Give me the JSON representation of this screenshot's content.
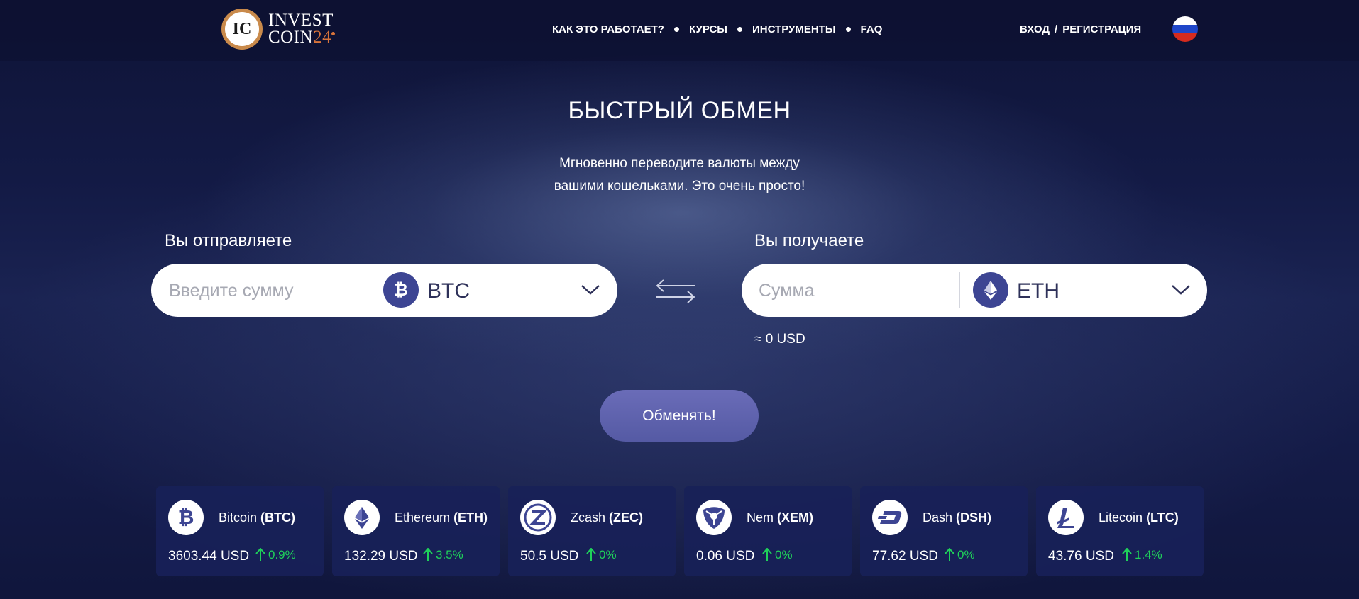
{
  "header": {
    "logo": {
      "line1": "INVEST",
      "line2": "COIN",
      "line2_num": "24",
      "mark": "IC"
    },
    "nav": [
      "КАК ЭТО РАБОТАЕТ?",
      "КУРСЫ",
      "ИНСТРУМЕНТЫ",
      "FAQ"
    ],
    "login": "ВХОД",
    "slash": "/",
    "register": "РЕГИСТРАЦИЯ",
    "flag": "russia-flag-icon"
  },
  "hero": {
    "title": "БЫСТРЫЙ ОБМЕН",
    "subtitle_line1": "Мгновенно переводите валюты между",
    "subtitle_line2": "вашими кошельками. Это очень просто!"
  },
  "exchange": {
    "send_label": "Вы отправляете",
    "send_placeholder": "Введите сумму",
    "send_currency": "BTC",
    "receive_label": "Вы получаете",
    "receive_placeholder": "Сумма",
    "receive_currency": "ETH",
    "usd_estimate": "≈ 0 USD",
    "submit": "Обменять!"
  },
  "tickers": [
    {
      "icon": "bitcoin-icon",
      "name": "Bitcoin",
      "code": "(BTC)",
      "price": "3603.44 USD",
      "change": "0.9%"
    },
    {
      "icon": "ethereum-icon",
      "name": "Ethereum",
      "code": "(ETH)",
      "price": "132.29 USD",
      "change": "3.5%"
    },
    {
      "icon": "zcash-icon",
      "name": "Zcash",
      "code": "(ZEC)",
      "price": "50.5 USD",
      "change": "0%"
    },
    {
      "icon": "nem-icon",
      "name": "Nem",
      "code": "(XEM)",
      "price": "0.06 USD",
      "change": "0%"
    },
    {
      "icon": "dash-icon",
      "name": "Dash",
      "code": "(DSH)",
      "price": "77.62 USD",
      "change": "0%"
    },
    {
      "icon": "litecoin-icon",
      "name": "Litecoin",
      "code": "(LTC)",
      "price": "43.76 USD",
      "change": "1.4%"
    }
  ],
  "colors": {
    "accent": "#3d4593",
    "positive": "#1fd15a",
    "button": "#5f62ae",
    "logo_orange": "#d9743a"
  }
}
